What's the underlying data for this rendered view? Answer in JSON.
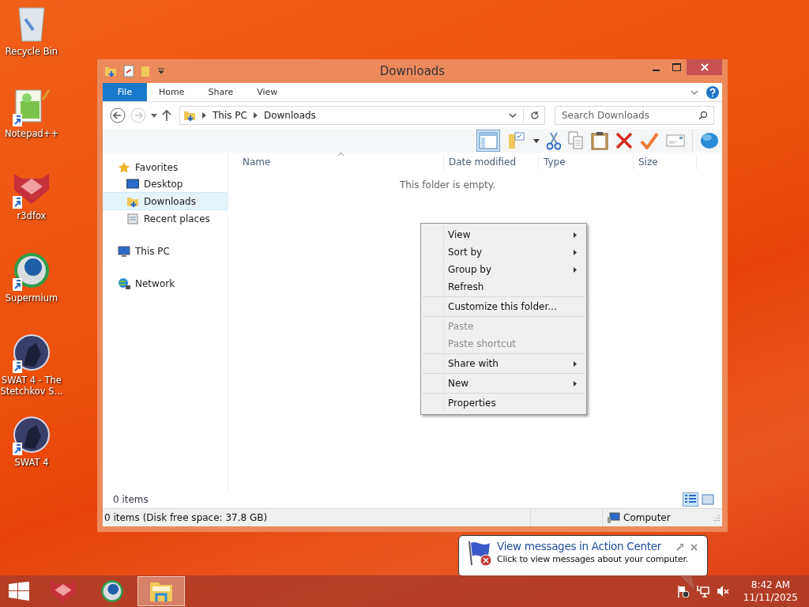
{
  "desktop_icons": [
    {
      "label": "Recycle Bin",
      "kind": "recycle",
      "shortcut": false
    },
    {
      "label": "Notepad++",
      "kind": "notepad",
      "shortcut": true
    },
    {
      "label": "r3dfox",
      "kind": "fox",
      "shortcut": true
    },
    {
      "label": "Supermium",
      "kind": "browser",
      "shortcut": true
    },
    {
      "label": "SWAT 4 - The Stetchkov S...",
      "kind": "game",
      "shortcut": true
    },
    {
      "label": "SWAT 4",
      "kind": "game",
      "shortcut": true
    }
  ],
  "window": {
    "title": "Downloads",
    "file_tab": "File",
    "ribbon_tabs": [
      {
        "label": "Home",
        "selected": false
      },
      {
        "label": "Share",
        "selected": false
      },
      {
        "label": "View",
        "selected": false
      }
    ],
    "breadcrumbs": [
      "This PC",
      "Downloads"
    ],
    "search": {
      "placeholder": "Search Downloads"
    },
    "navigation": [
      {
        "label": "Favorites",
        "kind": "star",
        "selected": false,
        "children": [
          {
            "label": "Desktop",
            "kind": "desktop",
            "selected": false
          },
          {
            "label": "Downloads",
            "kind": "downloads",
            "selected": true
          },
          {
            "label": "Recent places",
            "kind": "recent",
            "selected": false
          }
        ]
      },
      {
        "label": "This PC",
        "kind": "pc",
        "selected": false
      },
      {
        "label": "Network",
        "kind": "network",
        "selected": false
      }
    ],
    "columns": [
      "Name",
      "Date modified",
      "Type",
      "Size"
    ],
    "empty_message": "This folder is empty.",
    "item_count": "0 items",
    "status_text": "0 items (Disk free space: 37.8 GB)",
    "status_location": "Computer"
  },
  "context_menu": [
    [
      {
        "label": "View",
        "submenu": true,
        "disabled": false
      },
      {
        "label": "Sort by",
        "submenu": true,
        "disabled": false
      },
      {
        "label": "Group by",
        "submenu": true,
        "disabled": false
      },
      {
        "label": "Refresh",
        "submenu": false,
        "disabled": false
      }
    ],
    [
      {
        "label": "Customize this folder...",
        "submenu": false,
        "disabled": false
      }
    ],
    [
      {
        "label": "Paste",
        "submenu": false,
        "disabled": true
      },
      {
        "label": "Paste shortcut",
        "submenu": false,
        "disabled": true
      }
    ],
    [
      {
        "label": "Share with",
        "submenu": true,
        "disabled": false
      }
    ],
    [
      {
        "label": "New",
        "submenu": true,
        "disabled": false
      }
    ],
    [
      {
        "label": "Properties",
        "submenu": false,
        "disabled": false
      }
    ]
  ],
  "balloon": {
    "title": "View messages in Action Center",
    "message": "Click to view messages about your computer."
  },
  "taskbar": {
    "apps": [
      {
        "kind": "fox",
        "selected": false
      },
      {
        "kind": "browser",
        "selected": false
      },
      {
        "kind": "explorer",
        "selected": true
      }
    ],
    "time": "8:42 AM",
    "date": "11/11/2025"
  }
}
